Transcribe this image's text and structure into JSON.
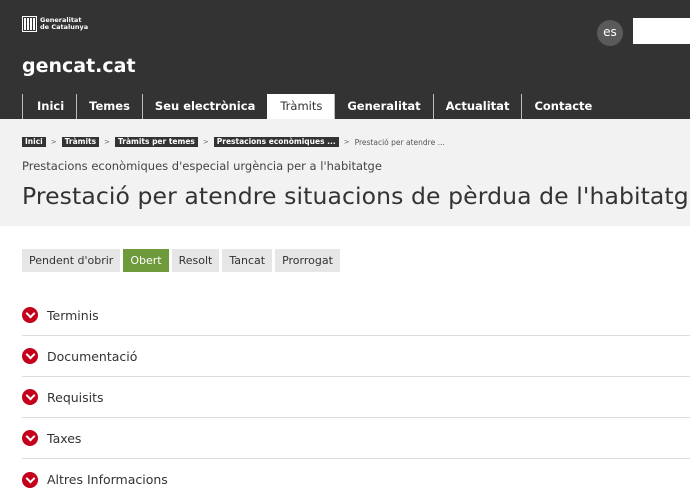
{
  "header": {
    "brand_line1": "Generalitat",
    "brand_line2": "de Catalunya",
    "site_name": "gencat.cat",
    "lang_label": "es",
    "search_placeholder": ""
  },
  "nav": [
    {
      "label": "Inici",
      "active": false
    },
    {
      "label": "Temes",
      "active": false
    },
    {
      "label": "Seu electrònica",
      "active": false
    },
    {
      "label": "Tràmits",
      "active": true
    },
    {
      "label": "Generalitat",
      "active": false
    },
    {
      "label": "Actualitat",
      "active": false
    },
    {
      "label": "Contacte",
      "active": false
    }
  ],
  "breadcrumb": {
    "items": [
      "Inici",
      "Tràmits",
      "Tràmits per temes",
      "Prestacions econòmiques ..."
    ],
    "current": "Prestació per atendre ..."
  },
  "page": {
    "subtitle": "Prestacions econòmiques d'especial urgència per a l'habitatge",
    "title": "Prestació per atendre situacions de pèrdua de l'habitatge"
  },
  "status_tabs": [
    {
      "label": "Pendent d'obrir",
      "active": false
    },
    {
      "label": "Obert",
      "active": true
    },
    {
      "label": "Resolt",
      "active": false
    },
    {
      "label": "Tancat",
      "active": false
    },
    {
      "label": "Prorrogat",
      "active": false
    }
  ],
  "accordion": [
    {
      "label": "Terminis",
      "icon": "chevron-down-icon"
    },
    {
      "label": "Documentació",
      "icon": "chevron-down-icon"
    },
    {
      "label": "Requisits",
      "icon": "chevron-down-icon"
    },
    {
      "label": "Taxes",
      "icon": "chevron-down-icon"
    },
    {
      "label": "Altres Informacions",
      "icon": "chevron-down-icon"
    }
  ],
  "colors": {
    "header_bg": "#333333",
    "status_active": "#6f9a3c",
    "accordion_icon": "#c4001a"
  }
}
